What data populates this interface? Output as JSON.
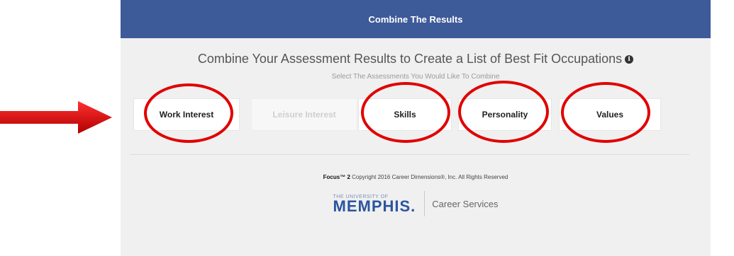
{
  "header": {
    "title": "Combine The Results"
  },
  "main": {
    "title": "Combine Your Assessment Results to Create a List of Best Fit Occupations",
    "info_glyph": "i",
    "subtitle": "Select The Assessments You Would Like To Combine"
  },
  "assessments": [
    {
      "label": "Work Interest",
      "enabled": true,
      "highlighted": true
    },
    {
      "label": "Leisure Interest",
      "enabled": false,
      "highlighted": false
    },
    {
      "label": "Skills",
      "enabled": true,
      "highlighted": true
    },
    {
      "label": "Personality",
      "enabled": true,
      "highlighted": true
    },
    {
      "label": "Values",
      "enabled": true,
      "highlighted": true
    }
  ],
  "footer": {
    "brand": "Focus™ 2",
    "copyright": "Copyright 2016 Career Dimensions®, Inc. All Rights Reserved",
    "logo_small": "THE UNIVERSITY OF",
    "logo_big": "MEMPHIS.",
    "logo_dept": "Career Services"
  },
  "colors": {
    "header_bg": "#3d5a99",
    "highlight_circle": "#e00000",
    "arrow": "#d40000"
  },
  "icons": {
    "annotation_arrow": "arrow-right-icon",
    "info": "info-icon"
  }
}
